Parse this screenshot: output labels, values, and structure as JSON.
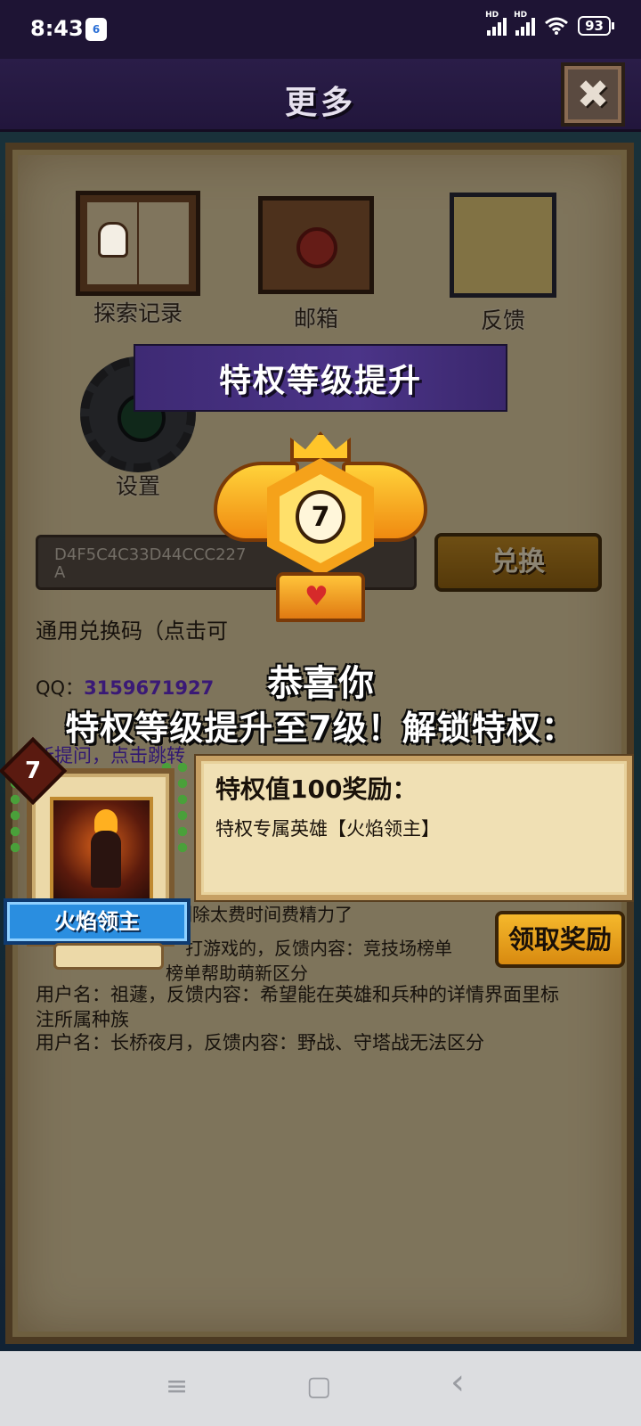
{
  "status_bar": {
    "time": "8:43",
    "notification_badge": "6",
    "battery": "93",
    "signal_1": "HD",
    "signal_2": "HD"
  },
  "header": {
    "title": "更多",
    "close_glyph": "✖"
  },
  "menu": [
    {
      "label": "探索记录",
      "icon": "book-icon"
    },
    {
      "label": "邮箱",
      "icon": "mailbox-icon"
    },
    {
      "label": "反馈",
      "icon": "scroll-icon"
    },
    {
      "label": "设置",
      "icon": "gear-icon"
    }
  ],
  "redeem": {
    "input_value_line1": "D4F5C4C33D44CCC227",
    "input_value_line2": "A",
    "button_label": "兑换",
    "code_hint": "通用兑换码（点击可"
  },
  "background_text": {
    "qq_label": "QQ：",
    "qq_number": "3159671927",
    "link_partial": "新提问，点击跳转",
    "feedback_1": "用户名：祖蘧，反馈内容：希望能在英雄和兵种的详情界面里标",
    "feedback_1b": "注所属种族",
    "feedback_2": "用户名：长桥夜月，反馈内容：野战、守塔战无法区分",
    "feedback_3": "打游戏的，反馈内容：竞技场榜单",
    "feedback_4": "榜单帮助萌新区分",
    "feedback_5": "删除太费时间费精力了"
  },
  "modal": {
    "banner_title": "特权等级提升",
    "badge_level": "7",
    "congrats": "恭喜你",
    "upgrade_message": "特权等级提升至7级！解锁特权：",
    "hero": {
      "level": "7",
      "name": "火焰领主"
    },
    "reward": {
      "title": "特权值100奖励：",
      "description": "特权专属英雄【火焰领主】"
    },
    "claim_button": "领取奖励"
  },
  "nav": {
    "menu_glyph": "≡",
    "home_glyph": "▢",
    "back_glyph": "‹"
  },
  "colors": {
    "header_bg": "#22163c",
    "banner_bg": "#4b3488",
    "claim_btn": "#f5b82c",
    "hero_name_bg": "#2a8ee0",
    "qq_number": "#6a2fd8"
  }
}
